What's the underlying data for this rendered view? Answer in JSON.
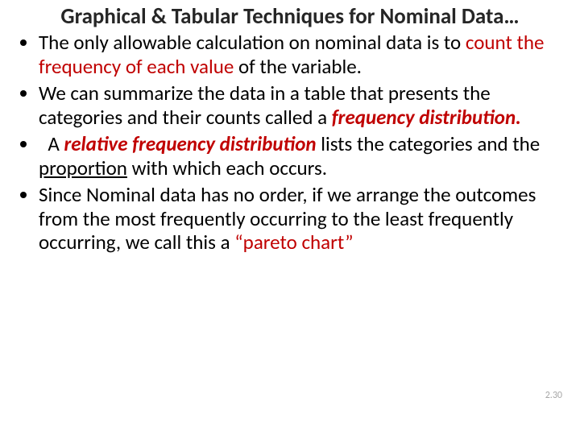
{
  "title": "Graphical & Tabular Techniques for Nominal Data…",
  "b1": {
    "a": "The only allowable calculation on nominal data is to ",
    "b": "count the frequency of each value",
    "c": " of the variable."
  },
  "b2": {
    "a": "We can summarize the data in a table that presents the categories and their counts called a ",
    "b": "frequency distribution."
  },
  "b3": {
    "a": "A ",
    "b": "relative frequency distribution",
    "c": " lists the categories and the ",
    "d": "proportion",
    "e": " with which each occurs."
  },
  "b4": {
    "a": "Since Nominal data has no order, if we arrange the outcomes from the most frequently occurring to the least frequently occurring, we call this a ",
    "b": "“pareto chart”"
  },
  "page": "2.30"
}
